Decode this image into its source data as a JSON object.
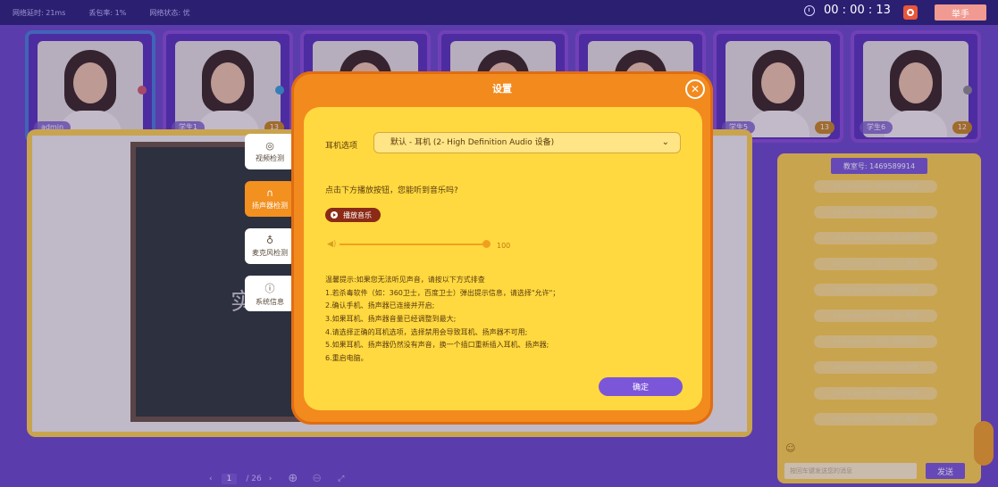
{
  "topbar": {
    "latency": "网络延时: 21ms",
    "loss": "丢包率: 1%",
    "network": "网络状态: 优",
    "timer": "00 : 00 : 13",
    "raise_hand": "举手"
  },
  "videos": [
    {
      "name": "admin",
      "stars": ""
    },
    {
      "name": "学生1",
      "stars": "13"
    },
    {
      "name": "",
      "stars": ""
    },
    {
      "name": "",
      "stars": ""
    },
    {
      "name": "",
      "stars": ""
    },
    {
      "name": "学生5",
      "stars": "13"
    },
    {
      "name": "学生6",
      "stars": "12"
    }
  ],
  "whiteboard": {
    "chalk_text": "实时",
    "page_current": "1",
    "page_total": "/ 26"
  },
  "side_tabs": [
    {
      "label": "视频检测",
      "icon": "camera-icon"
    },
    {
      "label": "扬声器检测",
      "icon": "headphones-icon"
    },
    {
      "label": "麦克风检测",
      "icon": "microphone-icon"
    },
    {
      "label": "系统信息",
      "icon": "info-icon"
    }
  ],
  "modal": {
    "title": "设置",
    "earphone_label": "耳机选项",
    "earphone_value": "默认 - 耳机 (2- High Definition Audio 设备)",
    "question": "点击下方播放按钮，您能听到音乐吗?",
    "play_label": "播放音乐",
    "volume": "100",
    "tips": [
      "温馨提示:如果您无法听见声音，请按以下方式排查",
      "1.若杀毒软件（如：360卫士，百度卫士）弹出提示信息，请选择\"允许\"；",
      "2.确认手机、扬声器已连接并开启;",
      "3.如果耳机、扬声器音量已经调整到最大;",
      "4.请选择正确的耳机选项，选择禁用会导致耳机、扬声器不可用;",
      "5.如果耳机、扬声器仍然没有声音，换一个插口重新插入耳机、扬声器;",
      "6.重启电脑。"
    ],
    "confirm": "确定"
  },
  "chat": {
    "classroom": "教室号: 1469589914",
    "messages": [
      "14:37 admin (老师) 离开教室",
      "14:37 admin (老师) 加入教室",
      "14:37 admin (老师) 离开教室",
      "14:37 admin (老师) 加入教室",
      "14:38 admin (老师) 离开教室",
      "14:38 admin (老师) 加入教室",
      "14:39 admin (老师) 离开教室",
      "14:39 admin (老师) 加入教室",
      "14:41 admin (老师) 离开教室",
      "14:41 admin (老师) 加入教室"
    ],
    "input_placeholder": "按回车键发送您的消息",
    "send": "发送"
  }
}
